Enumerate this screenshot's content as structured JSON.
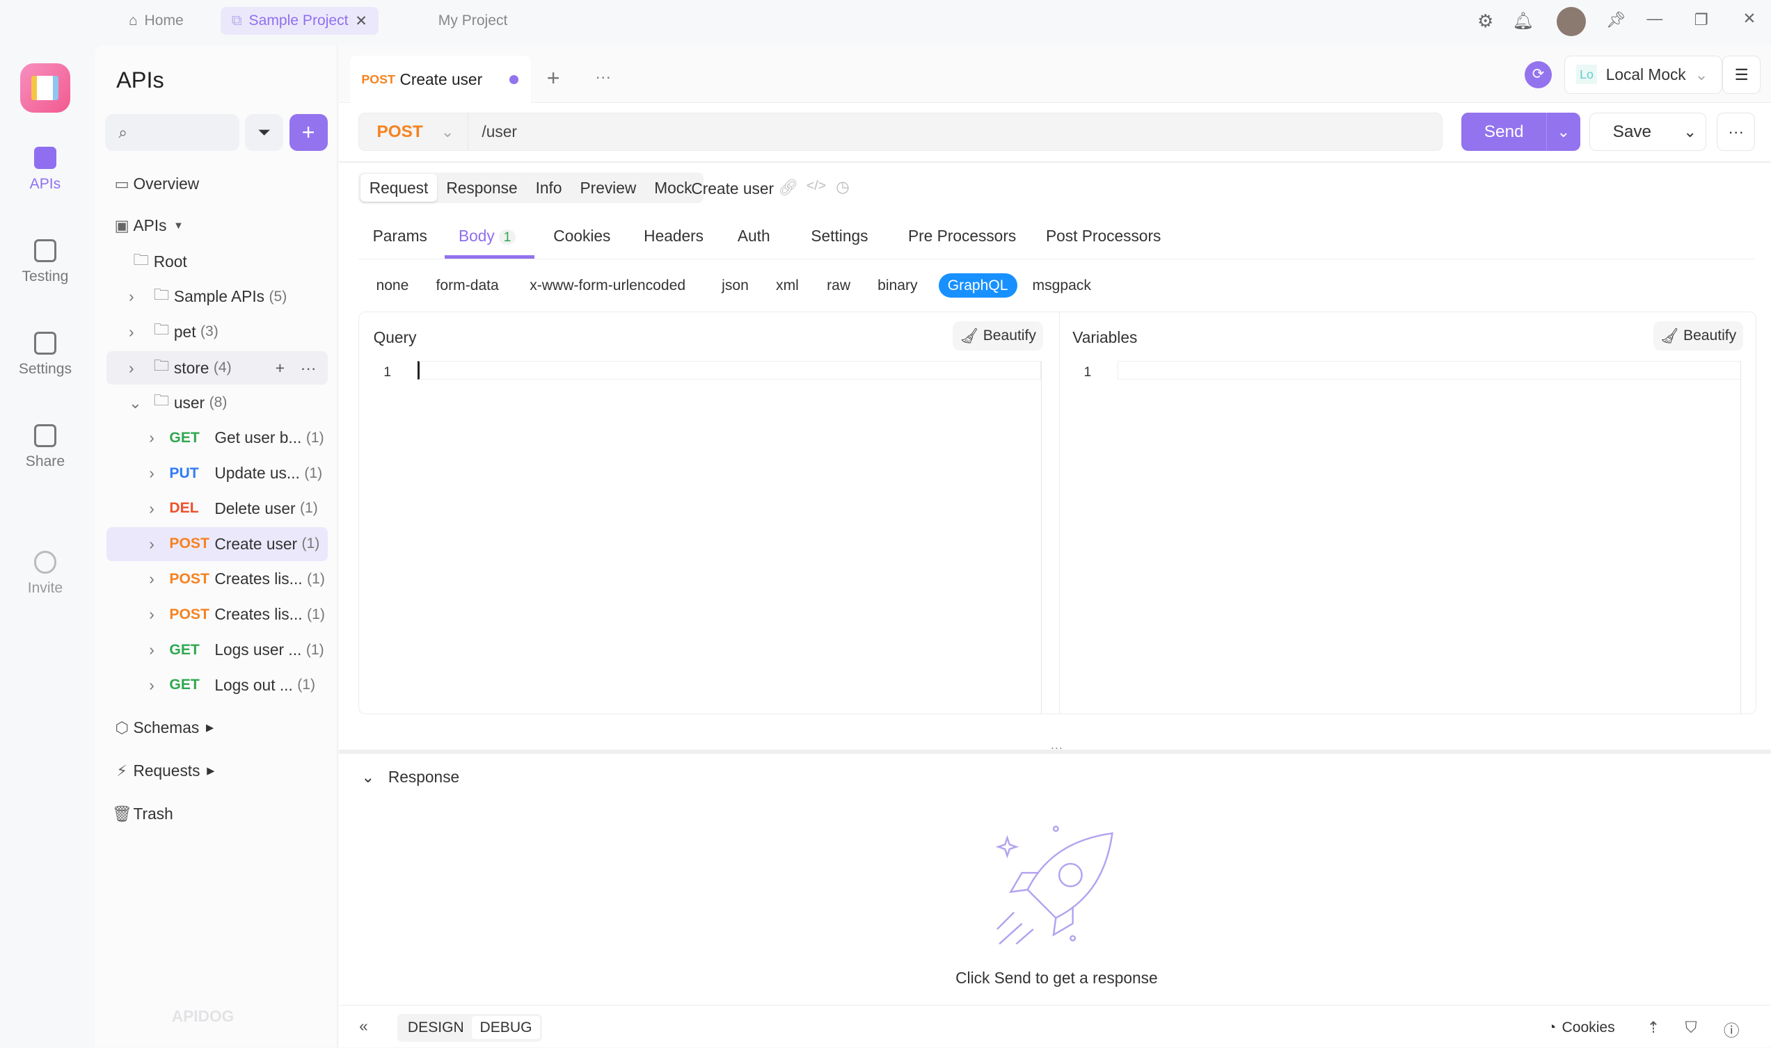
{
  "topbar": {
    "tabs": [
      {
        "label": "Home",
        "icon": "home-icon"
      },
      {
        "label": "Sample Project",
        "icon": "external-link-icon",
        "active": true
      },
      {
        "label": "My Project"
      }
    ]
  },
  "rail": {
    "items": [
      {
        "label": "APIs",
        "active": true
      },
      {
        "label": "Testing"
      },
      {
        "label": "Settings"
      },
      {
        "label": "Share"
      },
      {
        "label": "Invite"
      }
    ]
  },
  "sidebar": {
    "title": "APIs",
    "overview": "Overview",
    "apis": "APIs",
    "root": "Root",
    "folders": [
      {
        "name": "Sample APIs",
        "count": "(5)"
      },
      {
        "name": "pet",
        "count": "(3)"
      },
      {
        "name": "store",
        "count": "(4)"
      },
      {
        "name": "user",
        "count": "(8)"
      }
    ],
    "endpoints": [
      {
        "method": "GET",
        "name": "Get user b...",
        "count": "(1)"
      },
      {
        "method": "PUT",
        "name": "Update us...",
        "count": "(1)"
      },
      {
        "method": "DEL",
        "name": "Delete user",
        "count": "(1)"
      },
      {
        "method": "POST",
        "name": "Create user",
        "count": "(1)"
      },
      {
        "method": "POST",
        "name": "Creates lis...",
        "count": "(1)"
      },
      {
        "method": "POST",
        "name": "Creates lis...",
        "count": "(1)"
      },
      {
        "method": "GET",
        "name": "Logs user ...",
        "count": "(1)"
      },
      {
        "method": "GET",
        "name": "Logs out ...",
        "count": "(1)"
      }
    ],
    "schemas": "Schemas",
    "requests": "Requests",
    "trash": "Trash",
    "watermark": "APIDOG"
  },
  "colors": {
    "accent": "#9373ee",
    "get": "#2fa84f",
    "post": "#f5821f",
    "put": "#2f7cf6",
    "del": "#f0502a",
    "graphql": "#1890ff"
  },
  "editor_tab": {
    "method": "POST",
    "name": "Create user"
  },
  "env": {
    "badge": "Lo",
    "name": "Local Mock"
  },
  "request": {
    "method": "POST",
    "url": "/user",
    "send": "Send",
    "save": "Save"
  },
  "subtabs": [
    "Request",
    "Response",
    "Info",
    "Preview",
    "Mock"
  ],
  "subtab_name": "Create user",
  "body_tabs": [
    "Params",
    "Body",
    "Cookies",
    "Headers",
    "Auth",
    "Settings",
    "Pre Processors",
    "Post Processors"
  ],
  "body_count": "1",
  "body_types": [
    "none",
    "form-data",
    "x-www-form-urlencoded",
    "json",
    "xml",
    "raw",
    "binary",
    "GraphQL",
    "msgpack"
  ],
  "query": {
    "label": "Query",
    "beautify": "Beautify",
    "line": "1"
  },
  "variables": {
    "label": "Variables",
    "beautify": "Beautify",
    "line": "1"
  },
  "response": {
    "label": "Response",
    "empty": "Click Send to get a response"
  },
  "footer": {
    "design": "DESIGN",
    "debug": "DEBUG",
    "cookies": "Cookies"
  }
}
